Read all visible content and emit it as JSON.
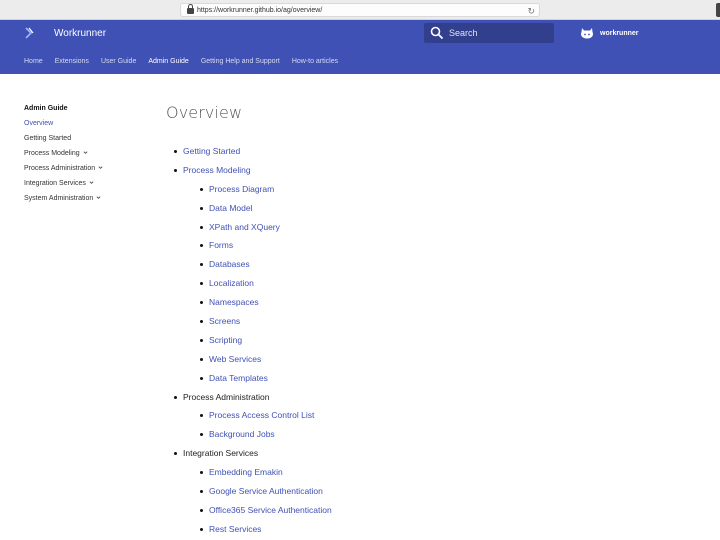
{
  "browser": {
    "url": "https://workrunner.github.io/ag/overview/"
  },
  "header": {
    "title": "Workrunner",
    "search_placeholder": "Search",
    "repo_name": "workrunner",
    "brand_color": "#3f51b5"
  },
  "nav": {
    "items": [
      {
        "label": "Home"
      },
      {
        "label": "Extensions"
      },
      {
        "label": "User Guide"
      },
      {
        "label": "Admin Guide",
        "active": true
      },
      {
        "label": "Getting Help and Support"
      },
      {
        "label": "How-to articles"
      }
    ]
  },
  "sidebar": {
    "title": "Admin Guide",
    "items": [
      {
        "label": "Overview",
        "active": true
      },
      {
        "label": "Getting Started"
      },
      {
        "label": "Process Modeling",
        "expandable": true
      },
      {
        "label": "Process Administration",
        "expandable": true
      },
      {
        "label": "Integration Services",
        "expandable": true
      },
      {
        "label": "System Administration",
        "expandable": true
      }
    ]
  },
  "main": {
    "title": "Overview",
    "toc": [
      {
        "label": "Getting Started",
        "link": true,
        "children": []
      },
      {
        "label": "Process Modeling",
        "link": true,
        "children": [
          {
            "label": "Process Diagram"
          },
          {
            "label": "Data Model"
          },
          {
            "label": "XPath and XQuery"
          },
          {
            "label": "Forms"
          },
          {
            "label": "Databases"
          },
          {
            "label": "Localization"
          },
          {
            "label": "Namespaces"
          },
          {
            "label": "Screens"
          },
          {
            "label": "Scripting"
          },
          {
            "label": "Web Services"
          },
          {
            "label": "Data Templates"
          }
        ]
      },
      {
        "label": "Process Administration",
        "link": false,
        "children": [
          {
            "label": "Process Access Control List"
          },
          {
            "label": "Background Jobs"
          }
        ]
      },
      {
        "label": "Integration Services",
        "link": false,
        "children": [
          {
            "label": "Embedding Emakin"
          },
          {
            "label": "Google Service Authentication"
          },
          {
            "label": "Office365 Service Authentication"
          },
          {
            "label": "Rest Services"
          }
        ]
      }
    ]
  }
}
